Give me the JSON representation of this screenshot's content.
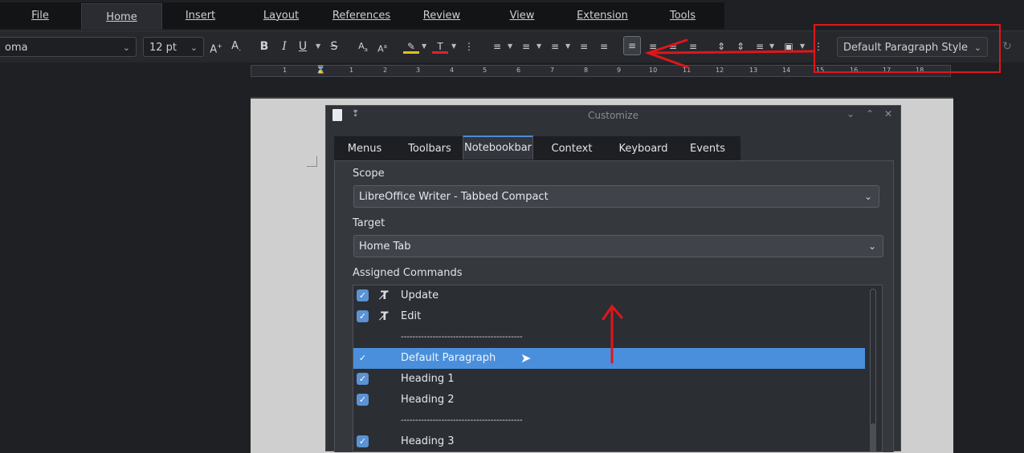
{
  "menu_tabs": [
    "File",
    "Home",
    "Insert",
    "Layout",
    "References",
    "Review",
    "View",
    "Extension",
    "Tools"
  ],
  "active_menu_tab": "Home",
  "toolbar": {
    "font_name": "oma",
    "font_size": "12 pt",
    "paragraph_style": "Default Paragraph Style"
  },
  "ruler": {
    "marks": [
      "1",
      "1",
      "2",
      "3",
      "4",
      "5",
      "6",
      "7",
      "8",
      "9",
      "10",
      "11",
      "12",
      "13",
      "14",
      "15",
      "16",
      "17",
      "18"
    ]
  },
  "dialog": {
    "title": "Customize",
    "tabs": [
      "Menus",
      "Toolbars",
      "Notebookbar",
      "Context Menus",
      "Keyboard",
      "Events"
    ],
    "selected_tab": "Notebookbar",
    "scope_label": "Scope",
    "scope_value": "LibreOffice Writer -  Tabbed Compact",
    "target_label": "Target",
    "target_value": "Home Tab",
    "assigned_label": "Assigned Commands",
    "commands": [
      {
        "label": "Update",
        "checked": true,
        "icon": "style-update-icon"
      },
      {
        "label": "Edit",
        "checked": true,
        "icon": "style-edit-icon"
      },
      {
        "label": "------------------------------------------",
        "checked": false,
        "separator": true
      },
      {
        "label": "Default Paragraph",
        "checked": true,
        "selected": true
      },
      {
        "label": "Heading 1",
        "checked": true
      },
      {
        "label": "Heading 2",
        "checked": true
      },
      {
        "label": "------------------------------------------",
        "checked": false,
        "separator": true
      },
      {
        "label": "Heading 3",
        "checked": true
      }
    ]
  },
  "colors": {
    "annotation_red": "#e0161a",
    "selection_blue": "#4a8fdc"
  }
}
